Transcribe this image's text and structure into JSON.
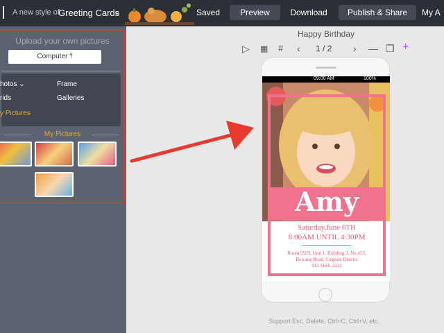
{
  "topbar": {
    "style_label": "A new style of",
    "style_value": "Greeting Cards",
    "saved": "Saved",
    "preview": "Preview",
    "download": "Download",
    "publish": "Publish & Share",
    "account": "My A"
  },
  "sidebar": {
    "upload_title": "Upload your own pictures",
    "computer_btn": "Computer",
    "sources": [
      "hotos",
      "Frame",
      "rids",
      "Galleries",
      "y Pictures"
    ],
    "my_pictures_title": "My Pictures"
  },
  "editor": {
    "title": "Happy Birthday",
    "page": "1 / 2",
    "footer": "Support Esc, Delete, Ctrl+C, Ctrl+V, etc."
  },
  "card": {
    "status_time": "09:00 AM",
    "status_batt": "100%",
    "name": "Amy",
    "date": "Saturday,June 6TH",
    "hours": "8:00AM UNTIL 4:30PM",
    "address": [
      "Room 0503, Unit 1, Building 3, No.453,",
      "Beicang Road, Cognate District",
      "012-6666-2222"
    ]
  },
  "colors": {
    "topbar": "#2c2f36",
    "sidebar": "#5b6270",
    "highlight": "#d43b35",
    "accent_orange": "#f5a623",
    "card_pink": "#f0728f",
    "plus_purple": "#b040e0"
  }
}
